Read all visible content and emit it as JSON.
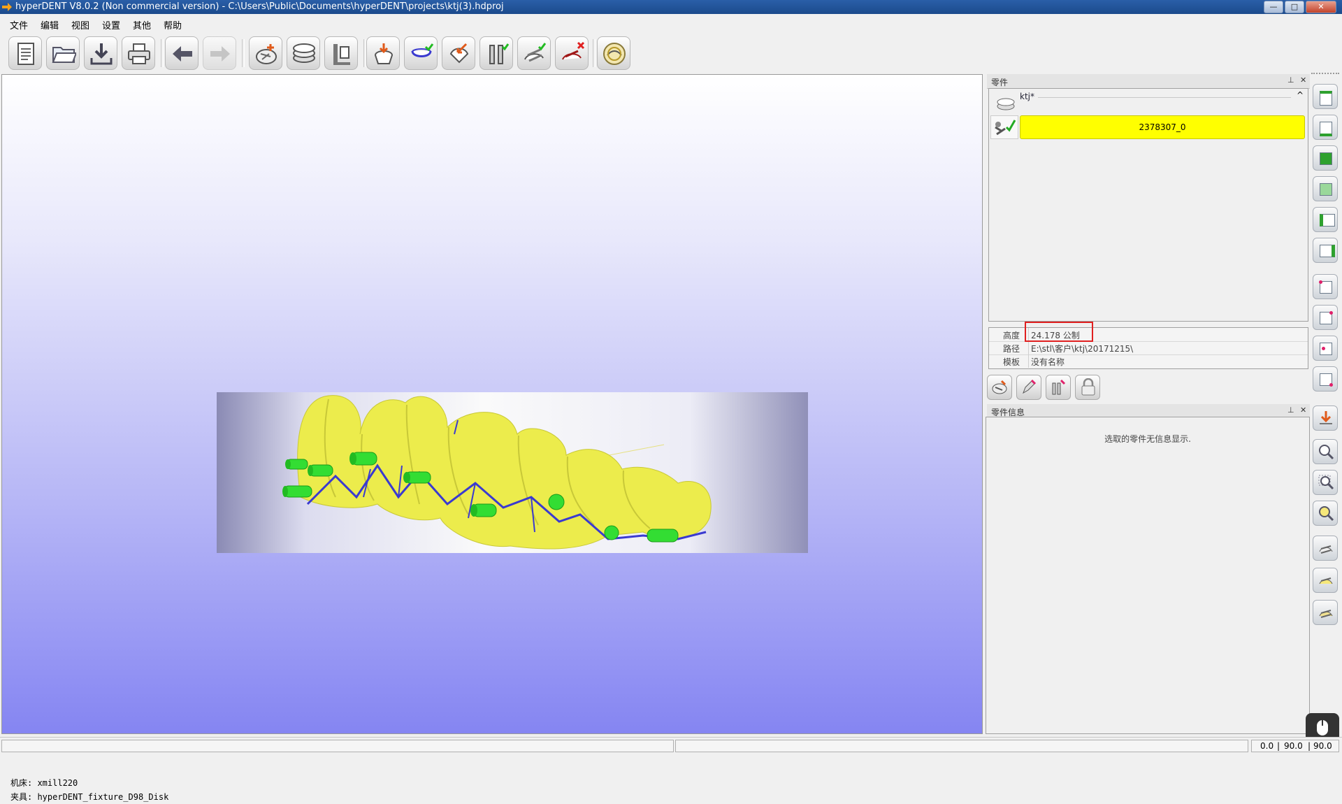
{
  "window": {
    "title": "hyperDENT V8.0.2 (Non commercial version) - C:\\Users\\Public\\Documents\\hyperDENT\\projects\\ktj(3).hdproj",
    "min_label": "—",
    "max_label": "□",
    "close_label": "✕"
  },
  "menu": [
    "文件",
    "编辑",
    "视图",
    "设置",
    "其他",
    "帮助"
  ],
  "toolbar": {
    "icons": [
      "new-document-icon",
      "open-folder-icon",
      "save-download-icon",
      "print-icon",
      "undo-arrow-icon",
      "redo-arrow-icon",
      "add-part-icon",
      "stock-disk-icon",
      "fixture-icon",
      "import-part-icon",
      "align-part-icon",
      "position-part-icon",
      "support-pins-icon",
      "connect-check-icon",
      "remove-connector-icon",
      "calculate-toolpath-icon"
    ]
  },
  "viewport": {
    "machine_label": "机床: xmill220",
    "fixture_label": "夹具: hyperDENT_fixture_D98_Disk"
  },
  "parts_panel": {
    "title": "零件",
    "pin_label": "⊥",
    "close_label": "✕",
    "root_name": "ktj*",
    "collapse_label": "^",
    "selected_part": "2378307_0"
  },
  "properties": [
    {
      "key": "高度",
      "value": "24.178 公制"
    },
    {
      "key": "路径",
      "value": "E:\\stl\\客户\\ktj\\20171215\\"
    },
    {
      "key": "模板",
      "value": "没有名称"
    }
  ],
  "part_info_panel": {
    "title": "零件信息",
    "pin_label": "⊥",
    "close_label": "✕",
    "message": "选取的零件无信息显示."
  },
  "status": {
    "coord_a": "0.0",
    "coord_b": "90.0",
    "coord_c": "90.0"
  },
  "colors": {
    "selected_row": "#ffff00",
    "part_yellow": "#ecec4c",
    "connector_green": "#33dd33",
    "outline_blue": "#3a3ad0",
    "highlight_box": "#e02020"
  }
}
